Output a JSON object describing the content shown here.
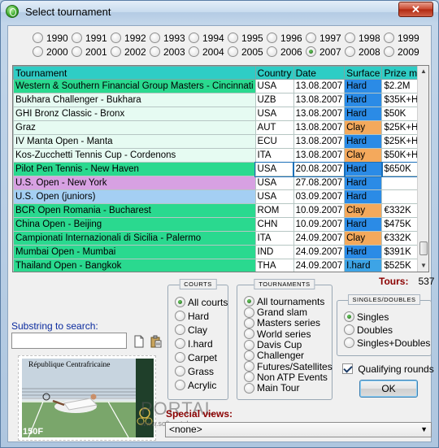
{
  "window": {
    "title": "Select tournament",
    "close": "✕"
  },
  "years": [
    {
      "label": "1990",
      "selected": false
    },
    {
      "label": "1991",
      "selected": false
    },
    {
      "label": "1992",
      "selected": false
    },
    {
      "label": "1993",
      "selected": false
    },
    {
      "label": "1994",
      "selected": false
    },
    {
      "label": "1995",
      "selected": false
    },
    {
      "label": "1996",
      "selected": false
    },
    {
      "label": "1997",
      "selected": false
    },
    {
      "label": "1998",
      "selected": false
    },
    {
      "label": "1999",
      "selected": false
    },
    {
      "label": "2000",
      "selected": false
    },
    {
      "label": "2001",
      "selected": false
    },
    {
      "label": "2002",
      "selected": false
    },
    {
      "label": "2003",
      "selected": false
    },
    {
      "label": "2004",
      "selected": false
    },
    {
      "label": "2005",
      "selected": false
    },
    {
      "label": "2006",
      "selected": false
    },
    {
      "label": "2007",
      "selected": true
    },
    {
      "label": "2008",
      "selected": false
    },
    {
      "label": "2009",
      "selected": false
    }
  ],
  "table": {
    "columns": [
      "Tournament",
      "Country",
      "Date",
      "Surface",
      "Prize money"
    ],
    "rows": [
      {
        "tournament": "Western & Southern Financial Group Masters - Cincinnati",
        "country": "USA",
        "date": "13.08.2007",
        "surface": "Hard",
        "prize": "$2.2M",
        "bg": "#2ad98f"
      },
      {
        "tournament": "Bukhara Challenger - Bukhara",
        "country": "UZB",
        "date": "13.08.2007",
        "surface": "Hard",
        "prize": "$35K+H",
        "bg": "#e6fbf2"
      },
      {
        "tournament": "GHI Bronz Classic - Bronx",
        "country": "USA",
        "date": "13.08.2007",
        "surface": "Hard",
        "prize": "$50K",
        "bg": "#e6fbf2"
      },
      {
        "tournament": "Graz",
        "country": "AUT",
        "date": "13.08.2007",
        "surface": "Clay",
        "prize": "$25K+H",
        "bg": "#e6fbf2"
      },
      {
        "tournament": "IV Manta Open - Manta",
        "country": "ECU",
        "date": "13.08.2007",
        "surface": "Hard",
        "prize": "$25K+H",
        "bg": "#e6fbf2"
      },
      {
        "tournament": "Kos-Zucchetti Tennis Cup - Cordenons",
        "country": "ITA",
        "date": "13.08.2007",
        "surface": "Clay",
        "prize": "$50K+H",
        "bg": "#e6fbf2"
      },
      {
        "tournament": "Pilot Pen Tennis - New Haven",
        "country": "USA",
        "date": "20.08.2007",
        "surface": "Hard",
        "prize": "$650K",
        "bg": "#2ad98f"
      },
      {
        "tournament": "U.S. Open - New York",
        "country": "USA",
        "date": "27.08.2007",
        "surface": "Hard",
        "prize": "",
        "bg": "#d7a1e2"
      },
      {
        "tournament": "U.S. Open (juniors)",
        "country": "USA",
        "date": "03.09.2007",
        "surface": "Hard",
        "prize": "",
        "bg": "#a4cff3"
      },
      {
        "tournament": "BCR Open Romania - Bucharest",
        "country": "ROM",
        "date": "10.09.2007",
        "surface": "Clay",
        "prize": "€332K",
        "bg": "#2ad98f"
      },
      {
        "tournament": "China Open - Beijing",
        "country": "CHN",
        "date": "10.09.2007",
        "surface": "Hard",
        "prize": "$475K",
        "bg": "#2ad98f"
      },
      {
        "tournament": "Campionati Internazionali di Sicilia - Palermo",
        "country": "ITA",
        "date": "24.09.2007",
        "surface": "Clay",
        "prize": "€332K",
        "bg": "#2ad98f"
      },
      {
        "tournament": "Mumbai Open - Mumbai",
        "country": "IND",
        "date": "24.09.2007",
        "surface": "Hard",
        "prize": "$391K",
        "bg": "#2ad98f"
      },
      {
        "tournament": "Thailand Open - Bangkok",
        "country": "THA",
        "date": "24.09.2007",
        "surface": "I.hard",
        "prize": "$525K",
        "bg": "#2ad98f"
      }
    ],
    "surface_colors": {
      "Hard": "#2b8be6",
      "Clay": "#f4a95c",
      "I.hard": "#3da4e6"
    }
  },
  "tours": {
    "label": "Tours:",
    "count": "537"
  },
  "courts": {
    "title": "COURTS",
    "options": [
      {
        "label": "All courts",
        "selected": true
      },
      {
        "label": "Hard",
        "selected": false
      },
      {
        "label": "Clay",
        "selected": false
      },
      {
        "label": "I.hard",
        "selected": false
      },
      {
        "label": "Carpet",
        "selected": false
      },
      {
        "label": "Grass",
        "selected": false
      },
      {
        "label": "Acrylic",
        "selected": false
      }
    ]
  },
  "tournaments": {
    "title": "TOURNAMENTS",
    "options": [
      {
        "label": "All tournaments",
        "selected": true
      },
      {
        "label": "Grand slam",
        "selected": false
      },
      {
        "label": "Masters series",
        "selected": false
      },
      {
        "label": "World series",
        "selected": false
      },
      {
        "label": "Davis Cup",
        "selected": false
      },
      {
        "label": "Challenger",
        "selected": false
      },
      {
        "label": "Futures/Satellites",
        "selected": false
      },
      {
        "label": "Non ATP Events",
        "selected": false
      },
      {
        "label": "Main Tour",
        "selected": false
      }
    ]
  },
  "singles_doubles": {
    "title": "SINGLES/DOUBLES",
    "options": [
      {
        "label": "Singles",
        "selected": true
      },
      {
        "label": "Doubles",
        "selected": false
      },
      {
        "label": "Singles+Doubles",
        "selected": false
      }
    ]
  },
  "search": {
    "label": "Substring to search:",
    "value": ""
  },
  "qualifying": {
    "label": "Qualifying rounds",
    "checked": true
  },
  "ok_label": "OK",
  "special_views": {
    "label": "Special views:",
    "value": "<none>"
  },
  "stamp": {
    "text": "République Centrafricaine",
    "value": "150F"
  },
  "watermark": {
    "text": "PORTAL",
    "url": "www.softportal.com"
  }
}
